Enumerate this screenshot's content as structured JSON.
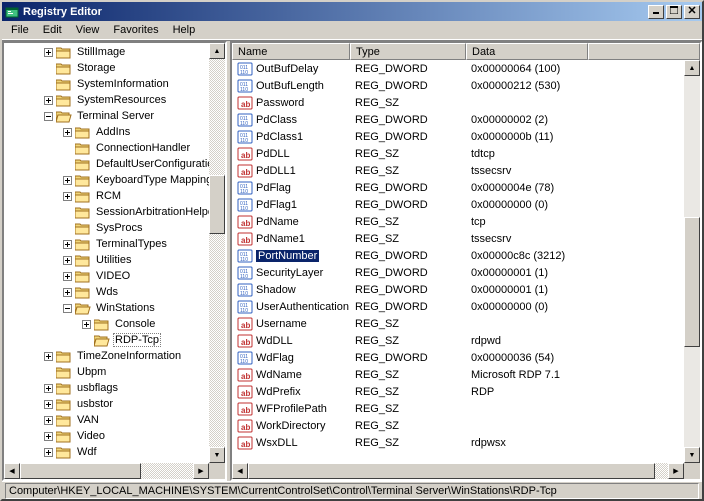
{
  "window": {
    "title": "Registry Editor"
  },
  "menu": {
    "file": "File",
    "edit": "Edit",
    "view": "View",
    "favorites": "Favorites",
    "help": "Help"
  },
  "titlebtns": {
    "min": "_",
    "max": "□",
    "close": "✕"
  },
  "scrollglyph": {
    "up": "▲",
    "down": "▼",
    "left": "◀",
    "right": "▶"
  },
  "columns": {
    "name": "Name",
    "type": "Type",
    "data": "Data"
  },
  "tree": {
    "items": [
      {
        "label": "StillImage",
        "depth": 2,
        "exp": "plus"
      },
      {
        "label": "Storage",
        "depth": 2,
        "exp": "none"
      },
      {
        "label": "SystemInformation",
        "depth": 2,
        "exp": "none"
      },
      {
        "label": "SystemResources",
        "depth": 2,
        "exp": "plus"
      },
      {
        "label": "Terminal Server",
        "depth": 2,
        "exp": "minus"
      },
      {
        "label": "AddIns",
        "depth": 3,
        "exp": "plus"
      },
      {
        "label": "ConnectionHandler",
        "depth": 3,
        "exp": "none"
      },
      {
        "label": "DefaultUserConfiguration",
        "depth": 3,
        "exp": "none"
      },
      {
        "label": "KeyboardType Mapping",
        "depth": 3,
        "exp": "plus"
      },
      {
        "label": "RCM",
        "depth": 3,
        "exp": "plus"
      },
      {
        "label": "SessionArbitrationHelper",
        "depth": 3,
        "exp": "none"
      },
      {
        "label": "SysProcs",
        "depth": 3,
        "exp": "none"
      },
      {
        "label": "TerminalTypes",
        "depth": 3,
        "exp": "plus"
      },
      {
        "label": "Utilities",
        "depth": 3,
        "exp": "plus"
      },
      {
        "label": "VIDEO",
        "depth": 3,
        "exp": "plus"
      },
      {
        "label": "Wds",
        "depth": 3,
        "exp": "plus"
      },
      {
        "label": "WinStations",
        "depth": 3,
        "exp": "minus"
      },
      {
        "label": "Console",
        "depth": 4,
        "exp": "plus"
      },
      {
        "label": "RDP-Tcp",
        "depth": 4,
        "exp": "none",
        "selected": true
      },
      {
        "label": "TimeZoneInformation",
        "depth": 2,
        "exp": "plus"
      },
      {
        "label": "Ubpm",
        "depth": 2,
        "exp": "none"
      },
      {
        "label": "usbflags",
        "depth": 2,
        "exp": "plus"
      },
      {
        "label": "usbstor",
        "depth": 2,
        "exp": "plus"
      },
      {
        "label": "VAN",
        "depth": 2,
        "exp": "plus"
      },
      {
        "label": "Video",
        "depth": 2,
        "exp": "plus"
      },
      {
        "label": "Wdf",
        "depth": 2,
        "exp": "plus"
      }
    ]
  },
  "values": [
    {
      "name": "OutBufDelay",
      "type": "REG_DWORD",
      "data": "0x00000064 (100)",
      "icon": "bin"
    },
    {
      "name": "OutBufLength",
      "type": "REG_DWORD",
      "data": "0x00000212 (530)",
      "icon": "bin"
    },
    {
      "name": "Password",
      "type": "REG_SZ",
      "data": "",
      "icon": "str"
    },
    {
      "name": "PdClass",
      "type": "REG_DWORD",
      "data": "0x00000002 (2)",
      "icon": "bin"
    },
    {
      "name": "PdClass1",
      "type": "REG_DWORD",
      "data": "0x0000000b (11)",
      "icon": "bin"
    },
    {
      "name": "PdDLL",
      "type": "REG_SZ",
      "data": "tdtcp",
      "icon": "str"
    },
    {
      "name": "PdDLL1",
      "type": "REG_SZ",
      "data": "tssecsrv",
      "icon": "str"
    },
    {
      "name": "PdFlag",
      "type": "REG_DWORD",
      "data": "0x0000004e (78)",
      "icon": "bin"
    },
    {
      "name": "PdFlag1",
      "type": "REG_DWORD",
      "data": "0x00000000 (0)",
      "icon": "bin"
    },
    {
      "name": "PdName",
      "type": "REG_SZ",
      "data": "tcp",
      "icon": "str"
    },
    {
      "name": "PdName1",
      "type": "REG_SZ",
      "data": "tssecsrv",
      "icon": "str"
    },
    {
      "name": "PortNumber",
      "type": "REG_DWORD",
      "data": "0x00000c8c (3212)",
      "icon": "bin",
      "selected": true
    },
    {
      "name": "SecurityLayer",
      "type": "REG_DWORD",
      "data": "0x00000001 (1)",
      "icon": "bin"
    },
    {
      "name": "Shadow",
      "type": "REG_DWORD",
      "data": "0x00000001 (1)",
      "icon": "bin"
    },
    {
      "name": "UserAuthentication",
      "type": "REG_DWORD",
      "data": "0x00000000 (0)",
      "icon": "bin"
    },
    {
      "name": "Username",
      "type": "REG_SZ",
      "data": "",
      "icon": "str"
    },
    {
      "name": "WdDLL",
      "type": "REG_SZ",
      "data": "rdpwd",
      "icon": "str"
    },
    {
      "name": "WdFlag",
      "type": "REG_DWORD",
      "data": "0x00000036 (54)",
      "icon": "bin"
    },
    {
      "name": "WdName",
      "type": "REG_SZ",
      "data": "Microsoft RDP 7.1",
      "icon": "str"
    },
    {
      "name": "WdPrefix",
      "type": "REG_SZ",
      "data": "RDP",
      "icon": "str"
    },
    {
      "name": "WFProfilePath",
      "type": "REG_SZ",
      "data": "",
      "icon": "str"
    },
    {
      "name": "WorkDirectory",
      "type": "REG_SZ",
      "data": "",
      "icon": "str"
    },
    {
      "name": "WsxDLL",
      "type": "REG_SZ",
      "data": "rdpwsx",
      "icon": "str"
    }
  ],
  "statusbar": {
    "path": "Computer\\HKEY_LOCAL_MACHINE\\SYSTEM\\CurrentControlSet\\Control\\Terminal Server\\WinStations\\RDP-Tcp"
  }
}
